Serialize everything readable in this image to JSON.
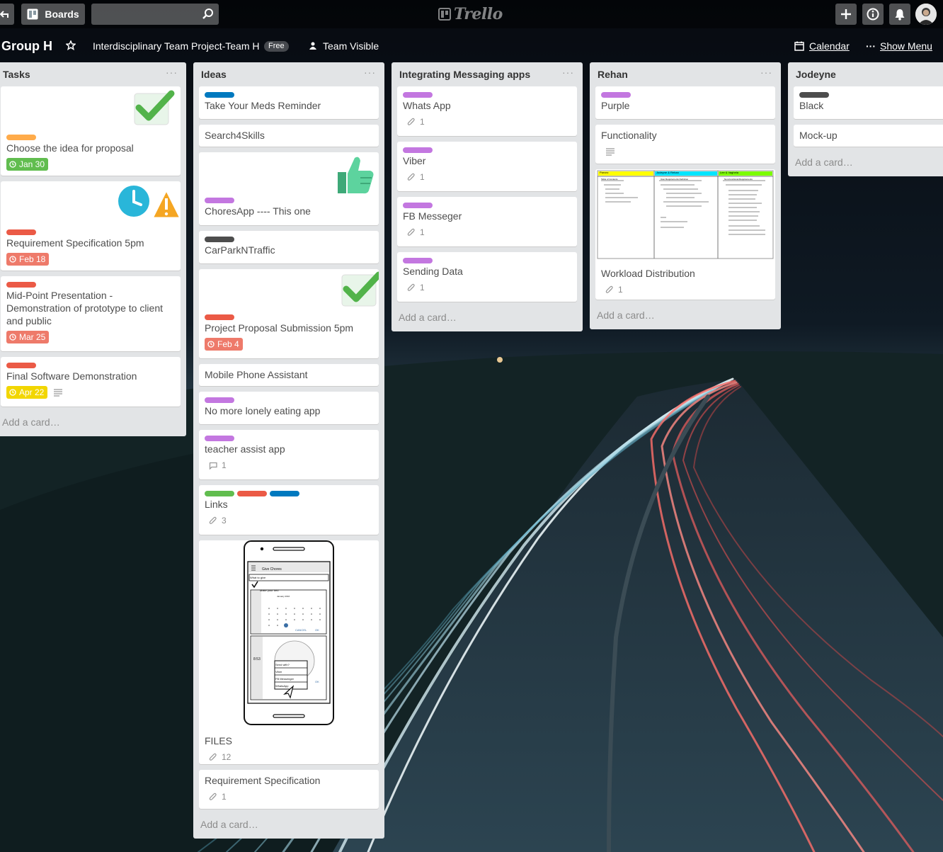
{
  "header": {
    "boards_label": "Boards",
    "search_placeholder": "",
    "logo_text": "Trello"
  },
  "board": {
    "title": "Group H",
    "team": "Interdisciplinary Team Project-Team H",
    "team_badge": "Free",
    "visibility": "Team Visible",
    "calendar": "Calendar",
    "show_menu": "Show Menu",
    "menu_dots": "···"
  },
  "colors": {
    "green": "#61bd4f",
    "yellow": "#f2d600",
    "orange": "#ffab4a",
    "red": "#eb5a46",
    "purple": "#c377e0",
    "blue": "#0079bf",
    "black": "#4d4d4d"
  },
  "lists": [
    {
      "title": "Tasks",
      "cards": [
        {
          "title": "Choose the idea for proposal",
          "labels": [
            "orange"
          ],
          "due": "Jan 30",
          "due_color": "green",
          "sticker": "check-sticker"
        },
        {
          "title": "Requirement Specification 5pm",
          "labels": [
            "red"
          ],
          "due": "Feb 18",
          "due_color": "red",
          "sticker": "clock-warning-sticker"
        },
        {
          "title": "Mid-Point Presentation - Demonstration of prototype to client and public",
          "labels": [
            "red"
          ],
          "due": "Mar 25",
          "due_color": "red"
        },
        {
          "title": "Final Software Demonstration",
          "labels": [
            "red"
          ],
          "due": "Apr 22",
          "due_color": "yellow",
          "description": true
        }
      ],
      "add_card": "Add a card…"
    },
    {
      "title": "Ideas",
      "cards": [
        {
          "title": "Take Your Meds Reminder",
          "labels": [
            "blue"
          ]
        },
        {
          "title": "Search4Skills"
        },
        {
          "title": "ChoresApp ---- This one",
          "labels": [
            "purple"
          ],
          "sticker": "thumbs-up-sticker"
        },
        {
          "title": "CarParkNTraffic",
          "labels": [
            "black"
          ]
        },
        {
          "title": "Project Proposal Submission 5pm",
          "labels": [
            "red"
          ],
          "due": "Feb 4",
          "due_color": "red",
          "sticker": "check-sticker"
        },
        {
          "title": "Mobile Phone Assistant"
        },
        {
          "title": "No more lonely eating app",
          "labels": [
            "purple"
          ]
        },
        {
          "title": "teacher assist app",
          "labels": [
            "purple"
          ],
          "comments": "1"
        },
        {
          "title": "Links",
          "labels": [
            "green",
            "red",
            "blue"
          ],
          "attachments": "3"
        },
        {
          "title": "FILES",
          "attachments": "12",
          "cover": "phone-mockup",
          "mock": {
            "app_title": "Give Chores",
            "field": "What to give",
            "check": "Make your bed",
            "calendar_header": "January 2016",
            "cancel": "CANCEL",
            "ok": "OK",
            "time": "8:53",
            "popup_title": "Send with?",
            "options": [
              "Viber",
              "FB Messenger",
              "WhatsApp"
            ]
          }
        },
        {
          "title": "Requirement Specification",
          "attachments": "1"
        }
      ],
      "add_card": "Add a card…"
    },
    {
      "title": "Integrating Messaging apps",
      "cards": [
        {
          "title": "Whats App",
          "labels": [
            "purple"
          ],
          "attachments": "1"
        },
        {
          "title": "Viber",
          "labels": [
            "purple"
          ],
          "attachments": "1"
        },
        {
          "title": "FB Messeger",
          "labels": [
            "purple"
          ],
          "attachments": "1"
        },
        {
          "title": "Sending Data",
          "labels": [
            "purple"
          ],
          "attachments": "1"
        }
      ],
      "add_card": "Add a card…"
    },
    {
      "title": "Rehan",
      "cards": [
        {
          "title": "Purple",
          "labels": [
            "purple"
          ]
        },
        {
          "title": "Functionality",
          "description": true
        },
        {
          "title": "Workload Distribution",
          "attachments": "1",
          "cover": "document-table",
          "doc": {
            "col1": "Parvez",
            "col2": "Jodeyne & Rehan",
            "col3": "Lee & Vaghela",
            "row1": "Table of Contents",
            "row2": "User Requirements Definition",
            "row3": "Non-Functional Requirements"
          }
        }
      ],
      "add_card": "Add a card…"
    },
    {
      "title": "Jodeyne",
      "cards": [
        {
          "title": "Black",
          "labels": [
            "black"
          ]
        },
        {
          "title": "Mock-up"
        }
      ],
      "add_card": "Add a card…"
    }
  ]
}
